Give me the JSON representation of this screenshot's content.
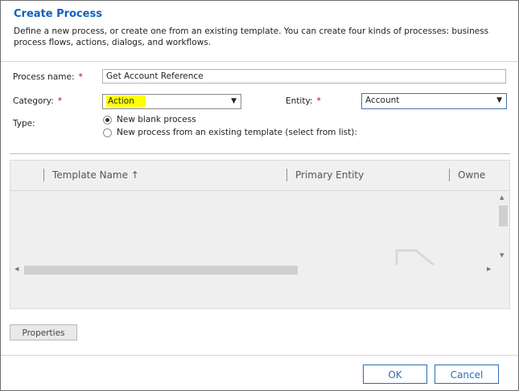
{
  "dialog": {
    "title": "Create Process",
    "description": "Define a new process, or create one from an existing template. You can create four kinds of processes: business process flows, actions, dialogs, and workflows."
  },
  "form": {
    "process_name_label": "Process name:",
    "process_name_value": "Get Account Reference",
    "category_label": "Category:",
    "category_value": "Action",
    "entity_label": "Entity:",
    "entity_value": "Account",
    "type_label": "Type:",
    "required_mark": "*",
    "type_options": [
      {
        "label": "New blank process",
        "checked": true
      },
      {
        "label": "New process from an existing template (select from list):",
        "checked": false
      }
    ]
  },
  "grid": {
    "columns": [
      "Template Name ↑",
      "Primary Entity",
      "Owne"
    ]
  },
  "buttons": {
    "properties": "Properties",
    "ok": "OK",
    "cancel": "Cancel"
  },
  "colors": {
    "title": "#1160b7",
    "highlight": "#ffff00",
    "required": "#c00000",
    "button_border": "#2e6bb5"
  }
}
